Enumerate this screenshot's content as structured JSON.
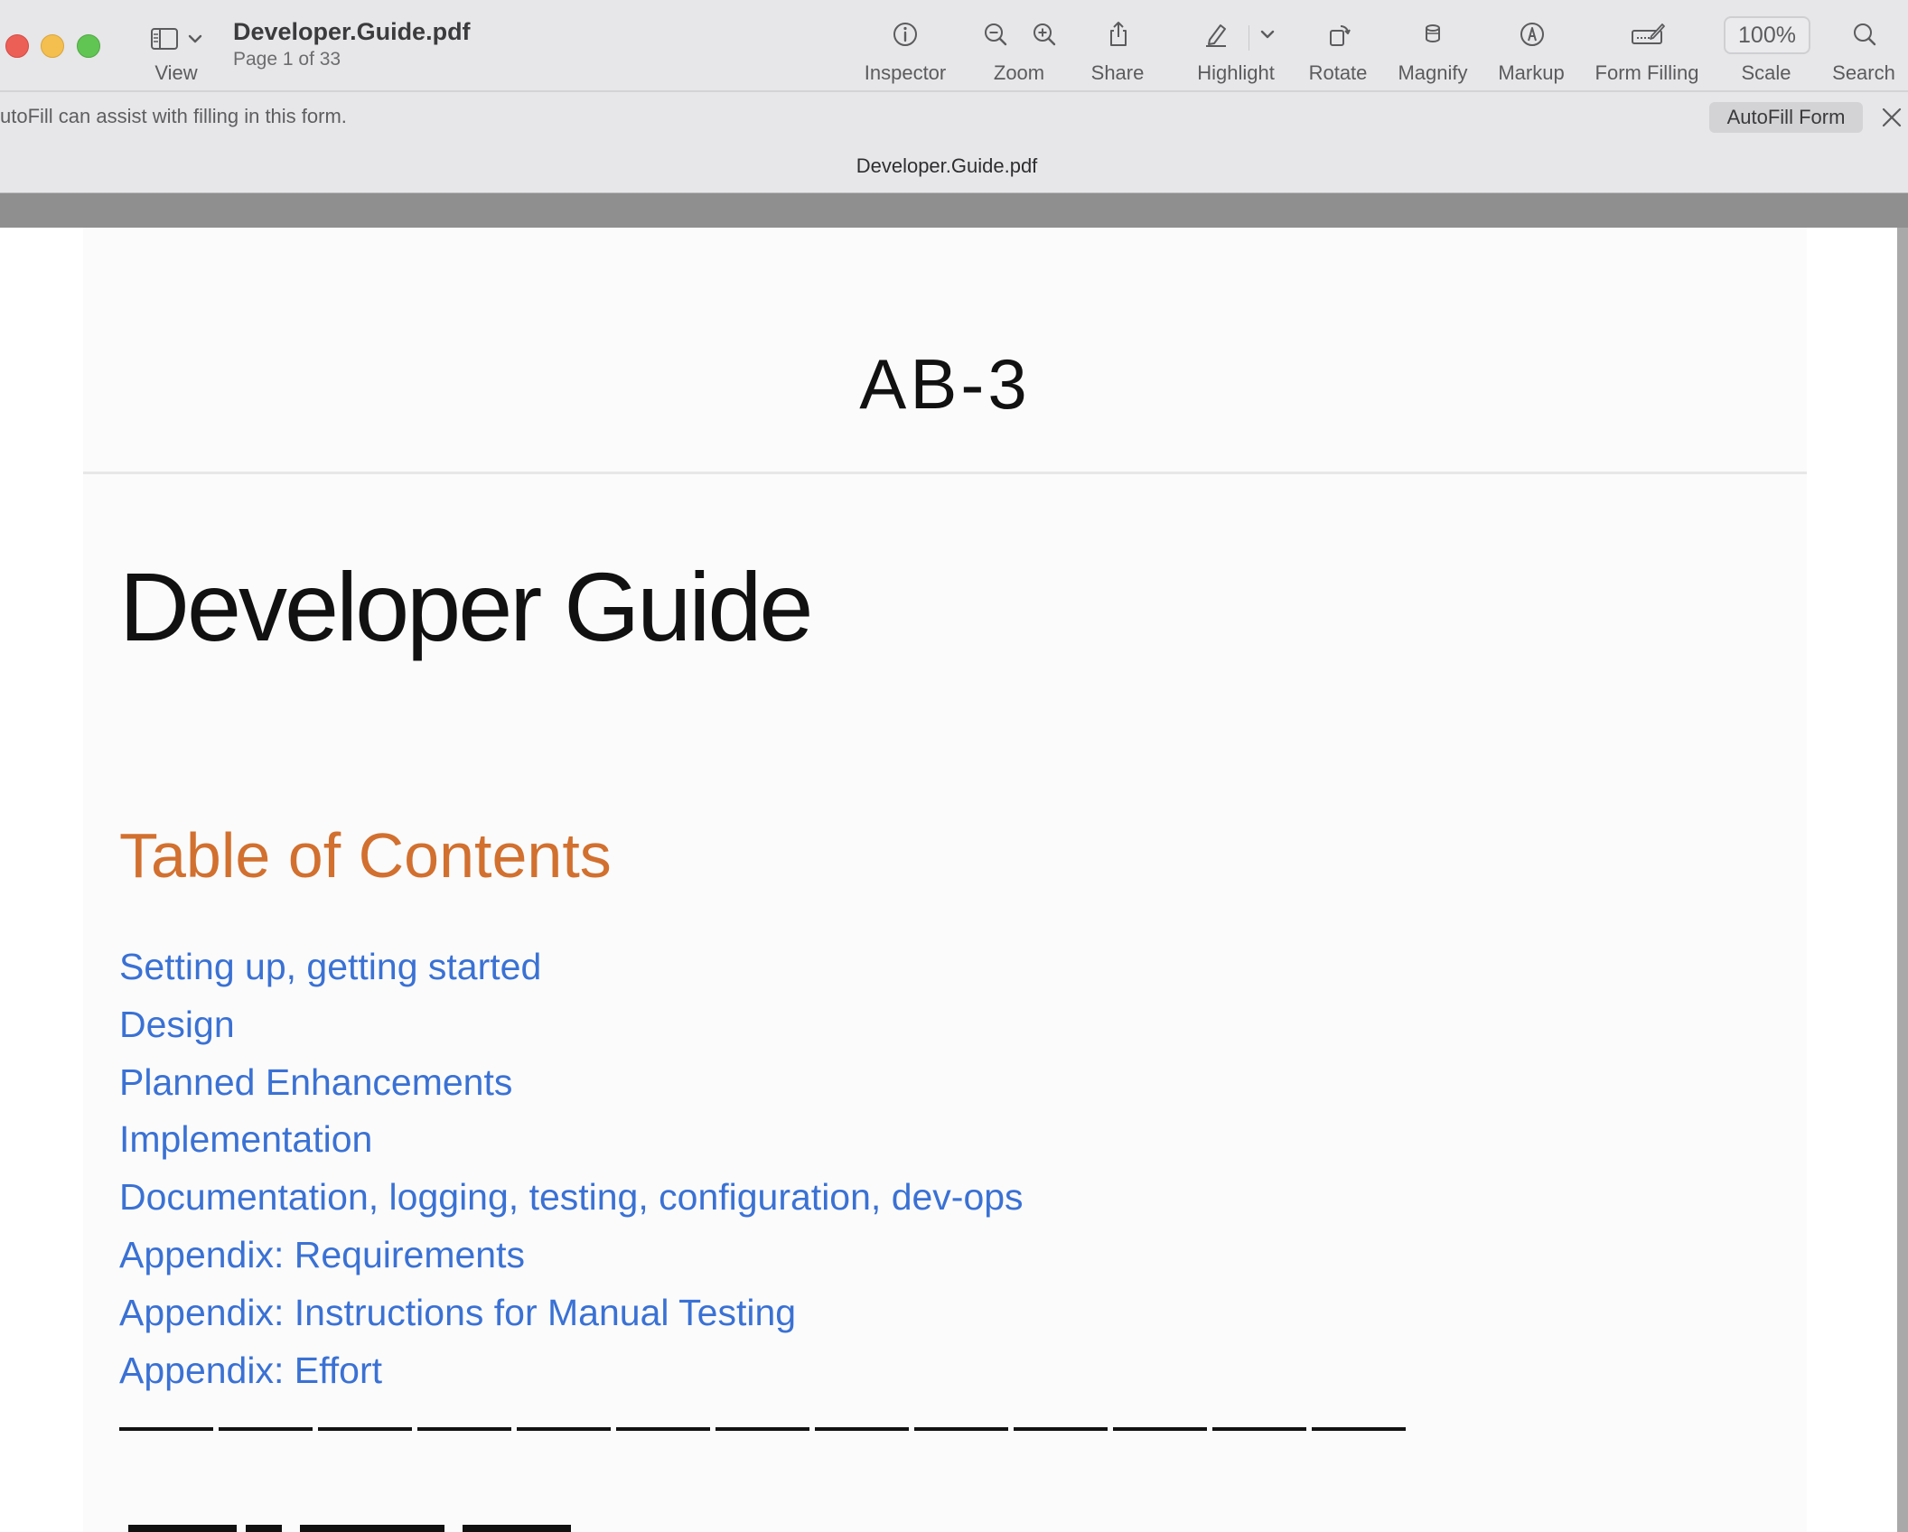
{
  "toolbar": {
    "title": "Developer.Guide.pdf",
    "page_info": "Page 1 of 33",
    "view_label": "View",
    "inspector_label": "Inspector",
    "zoom_label": "Zoom",
    "share_label": "Share",
    "highlight_label": "Highlight",
    "rotate_label": "Rotate",
    "magnify_label": "Magnify",
    "markup_label": "Markup",
    "form_filling_label": "Form Filling",
    "scale_value": "100%",
    "scale_label": "Scale",
    "search_label": "Search"
  },
  "autofill": {
    "message": "utoFill can assist with filling in this form.",
    "button_label": "AutoFill Form"
  },
  "file_strip": {
    "title": "Developer.Guide.pdf"
  },
  "document": {
    "code": "AB-3",
    "title": "Developer Guide",
    "toc_heading": "Table of Contents",
    "toc_items": [
      "Setting up, getting started",
      "Design",
      "Planned Enhancements",
      "Implementation",
      "Documentation, logging, testing, configuration, dev-ops",
      "Appendix: Requirements",
      "Appendix: Instructions for Manual Testing",
      "Appendix: Effort"
    ]
  },
  "colors": {
    "toc_heading": "#d2702f",
    "link": "#3a71d4",
    "toolbar_bg": "#e7e6e8"
  }
}
